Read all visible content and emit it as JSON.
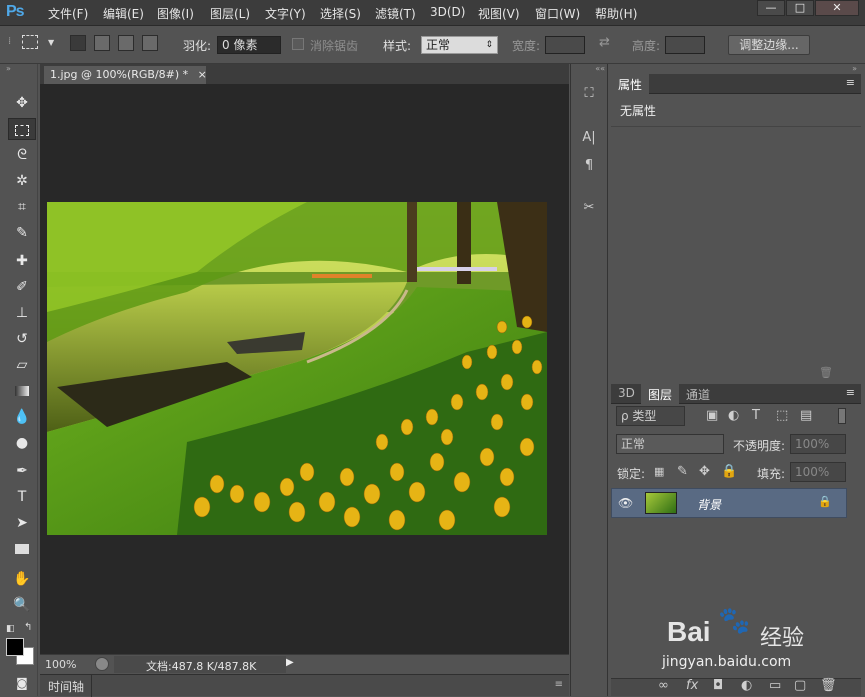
{
  "app": {
    "logo": "Ps"
  },
  "menu": [
    "文件(F)",
    "编辑(E)",
    "图像(I)",
    "图层(L)",
    "文字(Y)",
    "选择(S)",
    "滤镜(T)",
    "3D(D)",
    "视图(V)",
    "窗口(W)",
    "帮助(H)"
  ],
  "window_controls": {
    "minimize": "—",
    "maximize": "□",
    "close": "✕"
  },
  "options": {
    "feather_label": "羽化:",
    "feather_value": "0 像素",
    "antialias_label": "消除锯齿",
    "style_label": "样式:",
    "style_value": "正常",
    "width_label": "宽度:",
    "height_label": "高度:",
    "refine_button": "调整边缘..."
  },
  "document": {
    "tab_title": "1.jpg @ 100%(RGB/8#) *",
    "close": "×"
  },
  "status": {
    "zoom": "100%",
    "doc_info": "文档:487.8 K/487.8K"
  },
  "timeline": {
    "label": "时间轴"
  },
  "properties": {
    "tab": "属性",
    "content": "无属性"
  },
  "layers_panel": {
    "tabs": [
      "3D",
      "图层",
      "通道"
    ],
    "filter_label": "ρ 类型",
    "blend_mode": "正常",
    "opacity_label": "不透明度:",
    "opacity_value": "100%",
    "lock_label": "锁定:",
    "fill_label": "填充:",
    "fill_value": "100%",
    "layers": [
      {
        "name": "背景",
        "visible": true,
        "locked": true
      }
    ]
  },
  "watermark": {
    "brand": "Bai",
    "brand2": "经验",
    "url": "jingyan.baidu.com"
  },
  "colors": {
    "accent": "#4fa8e8",
    "selected_layer": "#596a83",
    "canvas_bg": "#282828",
    "panel_bg": "#535353"
  },
  "icons": {
    "tool_move": "move-icon",
    "tool_marquee": "rect-marquee-icon",
    "tool_lasso": "lasso-icon",
    "tool_wand": "magic-wand-icon",
    "tool_crop": "crop-icon",
    "tool_eyedropper": "eyedropper-icon",
    "tool_heal": "healing-brush-icon",
    "tool_brush": "brush-icon",
    "tool_stamp": "clone-stamp-icon",
    "tool_history": "history-brush-icon",
    "tool_eraser": "eraser-icon",
    "tool_gradient": "gradient-icon",
    "tool_blur": "blur-icon",
    "tool_dodge": "dodge-icon",
    "tool_pen": "pen-icon",
    "tool_type": "type-icon",
    "tool_path": "path-select-icon",
    "tool_shape": "rectangle-shape-icon",
    "tool_hand": "hand-icon",
    "tool_zoom": "zoom-icon"
  }
}
